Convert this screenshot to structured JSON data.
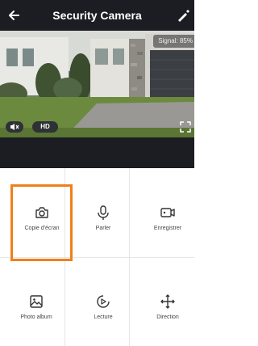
{
  "header": {
    "title": "Security Camera"
  },
  "video": {
    "signal_text": "Signal: 85%",
    "quality_label": "HD"
  },
  "actions": [
    {
      "label": "Copie d'écran",
      "icon": "camera-icon"
    },
    {
      "label": "Parler",
      "icon": "microphone-icon"
    },
    {
      "label": "Enregistrer",
      "icon": "video-record-icon"
    },
    {
      "label": "Photo album",
      "icon": "photo-album-icon"
    },
    {
      "label": "Lecture",
      "icon": "playback-icon"
    },
    {
      "label": "Direction",
      "icon": "direction-icon"
    }
  ],
  "colors": {
    "header_bg": "#1b1d22",
    "highlight": "#f07f1b"
  }
}
